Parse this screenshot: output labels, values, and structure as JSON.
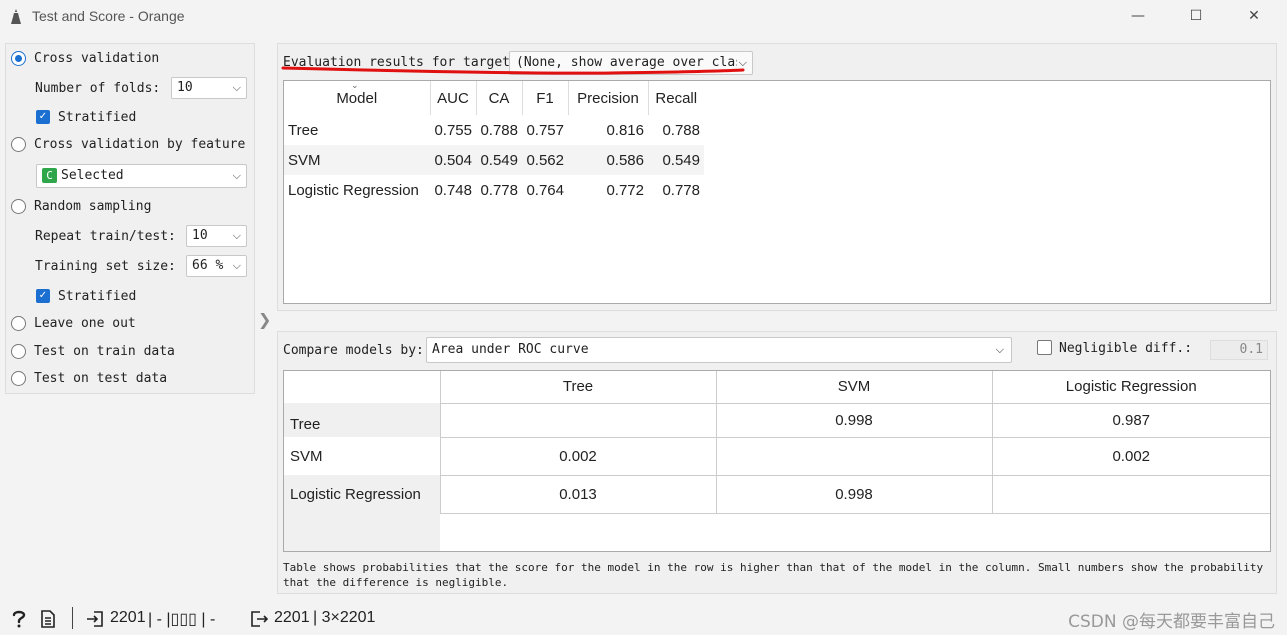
{
  "window": {
    "title": "Test and Score - Orange",
    "minimize": "—",
    "maximize": "☐",
    "close": "✕"
  },
  "sampling": {
    "cross_validation": "Cross validation",
    "folds_label": "Number of folds:",
    "folds_value": "10",
    "stratified_1": "Stratified",
    "cv_by_feature": "Cross validation by feature",
    "feature_badge": "C",
    "feature_value": "Selected",
    "random_sampling": "Random sampling",
    "repeat_label": "Repeat train/test:",
    "repeat_value": "10",
    "train_size_label": "Training set size:",
    "train_size_value": "66 %",
    "stratified_2": "Stratified",
    "leave_one_out": "Leave one out",
    "test_on_train": "Test on train data",
    "test_on_test": "Test on test data",
    "selected_method": "Cross validation"
  },
  "evaluation": {
    "target_label": "Evaluation results for target",
    "target_value": "(None, show average over clas",
    "columns": [
      "Model",
      "AUC",
      "CA",
      "F1",
      "Precision",
      "Recall"
    ],
    "rows": [
      {
        "model": "Tree",
        "auc": "0.755",
        "ca": "0.788",
        "f1": "0.757",
        "precision": "0.816",
        "recall": "0.788"
      },
      {
        "model": "SVM",
        "auc": "0.504",
        "ca": "0.549",
        "f1": "0.562",
        "precision": "0.586",
        "recall": "0.549"
      },
      {
        "model": "Logistic Regression",
        "auc": "0.748",
        "ca": "0.778",
        "f1": "0.764",
        "precision": "0.772",
        "recall": "0.778"
      }
    ]
  },
  "compare": {
    "label": "Compare models by:",
    "value": "Area under ROC curve",
    "negligible_label": "Negligible diff.:",
    "negligible_value": "0.1",
    "negligible_checked": false,
    "columns": [
      "Tree",
      "SVM",
      "Logistic Regression"
    ],
    "rows": [
      {
        "model": "Tree",
        "values": [
          "",
          "0.998",
          "0.987"
        ]
      },
      {
        "model": "SVM",
        "values": [
          "0.002",
          "",
          "0.002"
        ]
      },
      {
        "model": "Logistic Regression",
        "values": [
          "0.013",
          "0.998",
          ""
        ]
      }
    ],
    "note": "Table shows probabilities that the score for the model in the row is higher than that of the model in the column. Small numbers show the probability that the difference is negligible."
  },
  "status": {
    "input_count": "2201",
    "input_summary": "| - |▯▯▯ | -",
    "output_count": "2201",
    "output_summary": "| 3×2201",
    "watermark": "CSDN @每天都要丰富自己"
  },
  "colors": {
    "accent": "#1a6fd0",
    "badge_green": "#2fa64a",
    "annotation_red": "#e01010"
  }
}
